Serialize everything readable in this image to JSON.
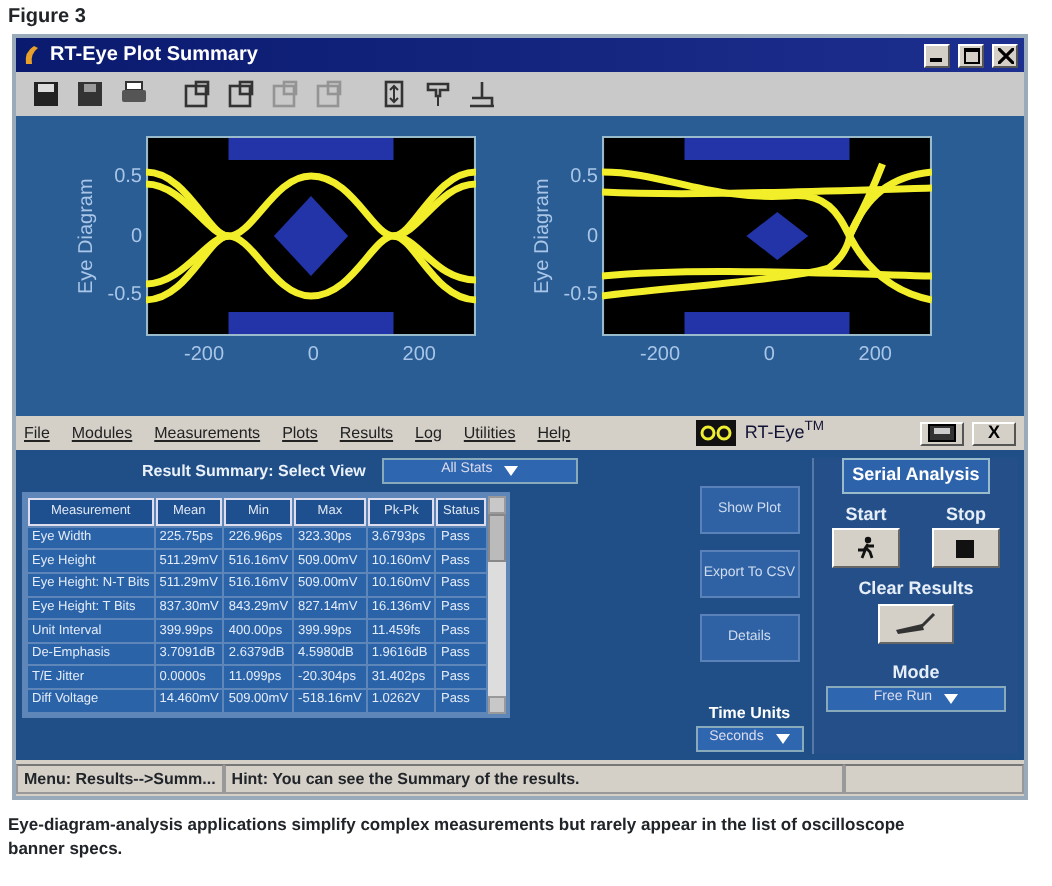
{
  "figure_label": "Figure 3",
  "window": {
    "title": "RT-Eye Plot Summary"
  },
  "toolbar": [
    {
      "kind": "save",
      "disabled": false
    },
    {
      "kind": "save-all",
      "disabled": false
    },
    {
      "kind": "print",
      "disabled": false
    },
    {
      "kind": "zoom",
      "disabled": false
    },
    {
      "kind": "zoom",
      "disabled": false
    },
    {
      "kind": "zoom",
      "disabled": true
    },
    {
      "kind": "zoom",
      "disabled": true
    },
    {
      "kind": "fit",
      "disabled": false
    },
    {
      "kind": "marker",
      "disabled": false
    },
    {
      "kind": "baseline",
      "disabled": false
    }
  ],
  "plots": [
    {
      "kind": "open",
      "y_label": "Eye Diagram",
      "y_ticks": [
        "0.5",
        "0",
        "-0.5"
      ],
      "x_ticks": [
        "-200",
        "0",
        "200"
      ]
    },
    {
      "kind": "closed",
      "y_label": "Eye Diagram",
      "y_ticks": [
        "0.5",
        "0",
        "-0.5"
      ],
      "x_ticks": [
        "-200",
        "0",
        "200"
      ]
    }
  ],
  "menu": [
    "File",
    "Modules",
    "Measurements",
    "Plots",
    "Results",
    "Log",
    "Utilities",
    "Help"
  ],
  "brand": {
    "name": "RT-Eye",
    "mark": "TM"
  },
  "panel_close": "X",
  "result_summary": {
    "label": "Result Summary: Select View",
    "view": "All Stats"
  },
  "table": {
    "columns": [
      "Measurement",
      "Mean",
      "Min",
      "Max",
      "Pk-Pk",
      "Status"
    ],
    "rows": [
      [
        "Eye Width",
        "225.75ps",
        "226.96ps",
        "323.30ps",
        "3.6793ps",
        "Pass"
      ],
      [
        "Eye Height",
        "511.29mV",
        "516.16mV",
        "509.00mV",
        "10.160mV",
        "Pass"
      ],
      [
        "Eye Height: N-T Bits",
        "511.29mV",
        "516.16mV",
        "509.00mV",
        "10.160mV",
        "Pass"
      ],
      [
        "Eye Height: T Bits",
        "837.30mV",
        "843.29mV",
        "827.14mV",
        "16.136mV",
        "Pass"
      ],
      [
        "Unit Interval",
        "399.99ps",
        "400.00ps",
        "399.99ps",
        "11.459fs",
        "Pass"
      ],
      [
        "De-Emphasis",
        "3.7091dB",
        "2.6379dB",
        "4.5980dB",
        "1.9616dB",
        "Pass"
      ],
      [
        "T/E Jitter",
        "0.0000s",
        "11.099ps",
        "-20.304ps",
        "31.402ps",
        "Pass"
      ],
      [
        "Diff Voltage",
        "14.460mV",
        "509.00mV",
        "-518.16mV",
        "1.0262V",
        "Pass"
      ]
    ]
  },
  "actions": [
    "Show Plot",
    "Export To CSV",
    "Details"
  ],
  "time_units": {
    "label": "Time Units",
    "value": "Seconds"
  },
  "serial": {
    "title": "Serial Analysis",
    "start": "Start",
    "stop": "Stop",
    "clear": "Clear Results",
    "mode_label": "Mode",
    "mode": "Free Run"
  },
  "status_bar": [
    "Menu: Results-->Summ...",
    "Hint: You can see the Summary of the results."
  ],
  "caption": "Eye-diagram-analysis applications simplify complex measurements but rarely appear in the list of oscilloscope banner specs."
}
